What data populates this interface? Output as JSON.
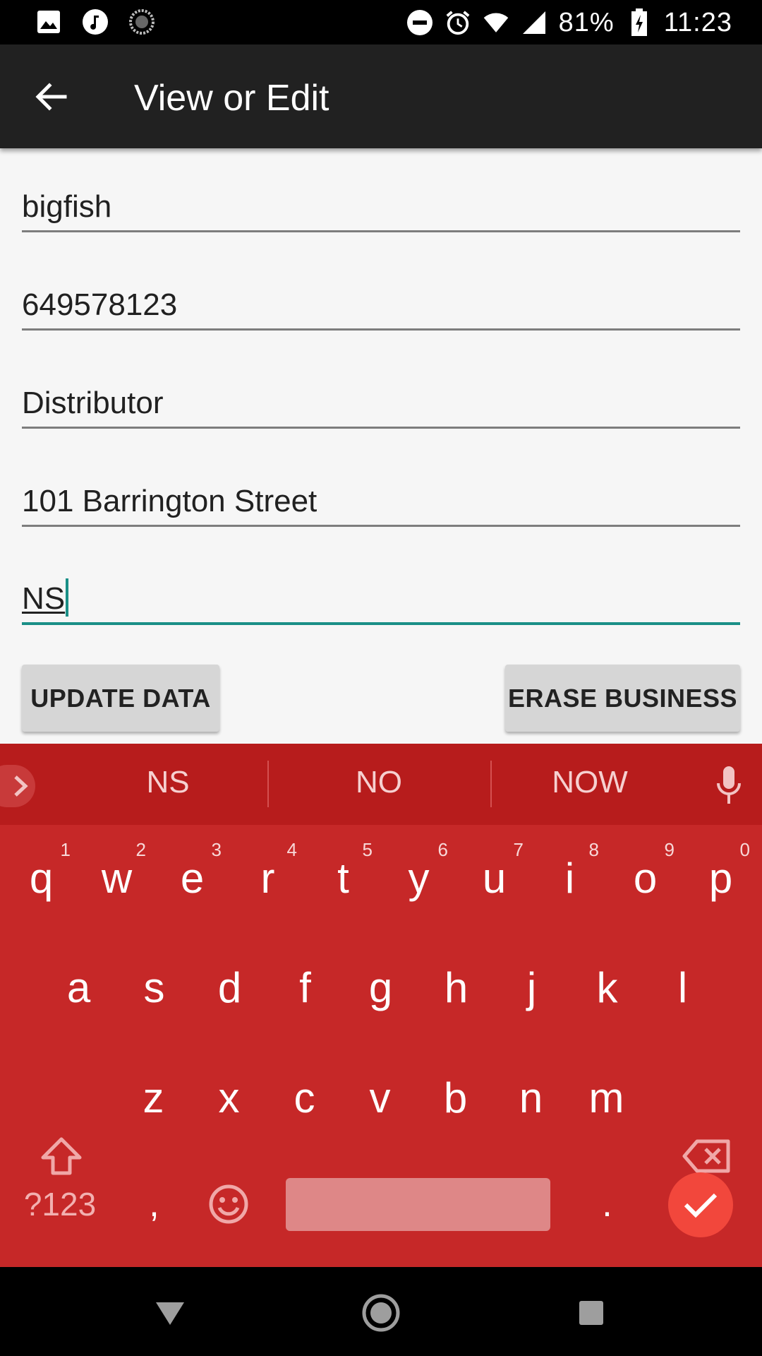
{
  "status_bar": {
    "battery": "81%",
    "time": "11:23"
  },
  "toolbar": {
    "title": "View or Edit"
  },
  "form": {
    "fields": [
      {
        "value": "bigfish"
      },
      {
        "value": "649578123"
      },
      {
        "value": "Distributor"
      },
      {
        "value": "101 Barrington Street"
      },
      {
        "value": "NS"
      }
    ],
    "update_label": "UPDATE DATA",
    "erase_label": "ERASE BUSINESS"
  },
  "keyboard": {
    "suggestions": [
      "NS",
      "NO",
      "NOW"
    ],
    "row1": [
      {
        "k": "q",
        "h": "1"
      },
      {
        "k": "w",
        "h": "2"
      },
      {
        "k": "e",
        "h": "3"
      },
      {
        "k": "r",
        "h": "4"
      },
      {
        "k": "t",
        "h": "5"
      },
      {
        "k": "y",
        "h": "6"
      },
      {
        "k": "u",
        "h": "7"
      },
      {
        "k": "i",
        "h": "8"
      },
      {
        "k": "o",
        "h": "9"
      },
      {
        "k": "p",
        "h": "0"
      }
    ],
    "row2": [
      "a",
      "s",
      "d",
      "f",
      "g",
      "h",
      "j",
      "k",
      "l"
    ],
    "row3": [
      "z",
      "x",
      "c",
      "v",
      "b",
      "n",
      "m"
    ],
    "symbols_label": "?123",
    "comma": ",",
    "period": ".",
    "accent_color": "#c62828"
  }
}
